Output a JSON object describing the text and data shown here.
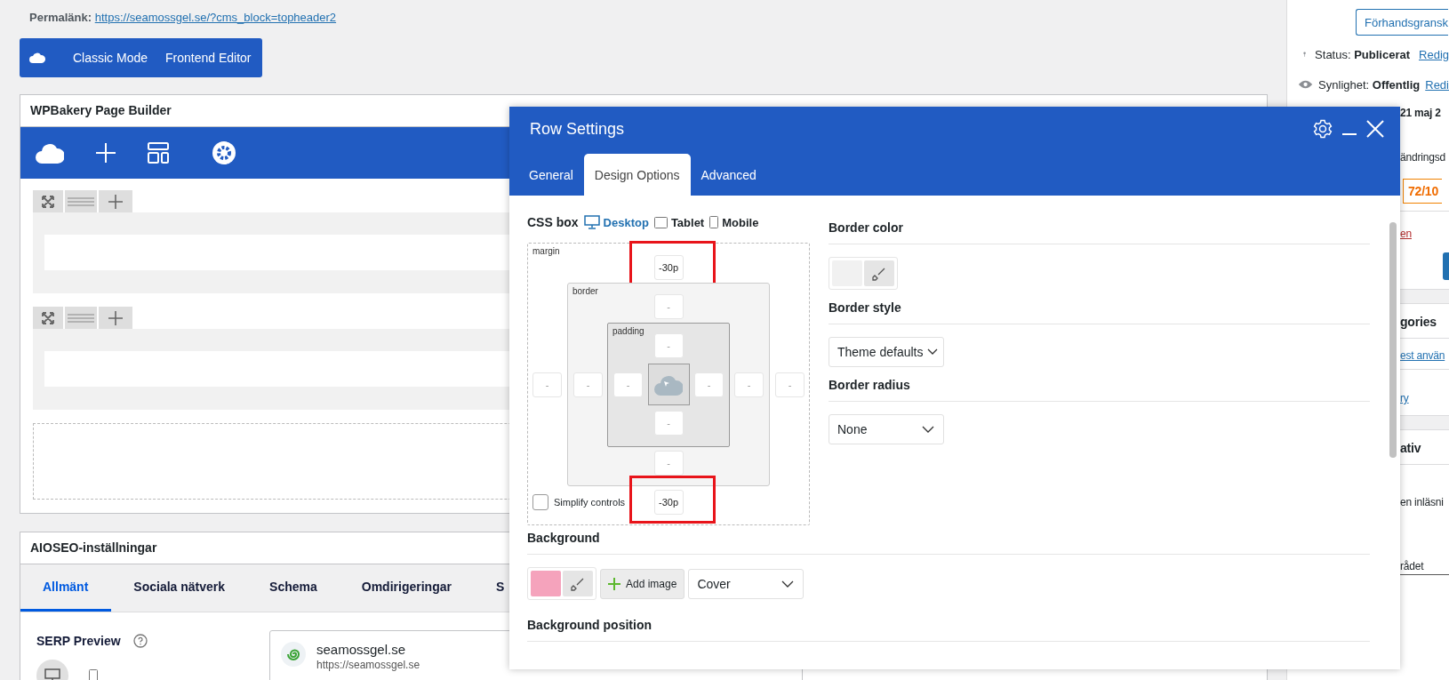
{
  "permalink": {
    "label": "Permalänk:",
    "url": "https://seamossgel.se/?cms_block=topheader2"
  },
  "editor_switch": {
    "buttons": [
      "Classic Mode",
      "Frontend Editor"
    ]
  },
  "page_builder": {
    "title": "WPBakery Page Builder"
  },
  "seo_panel": {
    "title": "AIOSEO-inställningar",
    "tabs": [
      {
        "label": "Allmänt",
        "selected": true
      },
      {
        "label": "Sociala nätverk",
        "selected": false
      },
      {
        "label": "Schema",
        "selected": false
      },
      {
        "label": "Omdirigeringar",
        "selected": false
      },
      {
        "label": "S",
        "selected": false
      }
    ],
    "serp_label": "SERP Preview",
    "serp_devices": [
      {
        "kind": "desktop",
        "selected": true
      },
      {
        "kind": "mobile",
        "selected": false
      }
    ],
    "site_name": "seamossgel.se",
    "site_url": "https://seamossgel.se"
  },
  "sidebar": {
    "preview_button": "Förhandsgransk",
    "status": {
      "label": "Status:",
      "value": "Publicerat",
      "link": "Redig"
    },
    "visibility": {
      "label": "Synlighet:",
      "value": "Offentlig",
      "link": "Redi"
    },
    "date": "21 maj 2",
    "revision": "ändringsd",
    "score": "72/10",
    "trash_link": "en",
    "categories_title": "gories",
    "categories_link": "est använ",
    "add_category_link": "ry",
    "section_title": "ativ",
    "note": "en inläsni",
    "field_label": "rådet"
  },
  "modal": {
    "title": "Row Settings",
    "tabs": [
      {
        "label": "General",
        "selected": false
      },
      {
        "label": "Design Options",
        "selected": true
      },
      {
        "label": "Advanced",
        "selected": false
      }
    ],
    "css_box": {
      "label": "CSS box",
      "devices": [
        {
          "kind": "desktop",
          "label": "Desktop",
          "selected": true
        },
        {
          "kind": "tablet",
          "label": "Tablet",
          "selected": false
        },
        {
          "kind": "mobile",
          "label": "Mobile",
          "selected": false
        }
      ],
      "margin": {
        "label": "margin",
        "top": {
          "value": "-30p",
          "highlighted": true
        },
        "right": {
          "placeholder": "-"
        },
        "bottom": {
          "value": "-30p",
          "highlighted": true
        },
        "left": {
          "placeholder": "-"
        }
      },
      "border": {
        "label": "border",
        "top": {
          "placeholder": "-"
        },
        "right": {
          "placeholder": "-"
        },
        "bottom": {
          "placeholder": "-"
        },
        "left": {
          "placeholder": "-"
        }
      },
      "padding": {
        "label": "padding",
        "top": {
          "placeholder": "-"
        },
        "right": {
          "placeholder": "-"
        },
        "bottom": {
          "placeholder": "-"
        },
        "left": {
          "placeholder": "-"
        }
      },
      "simplify": {
        "label": "Simplify controls",
        "checked": false
      }
    },
    "border_color": {
      "label": "Border color"
    },
    "border_style": {
      "label": "Border style",
      "value": "Theme defaults"
    },
    "border_radius": {
      "label": "Border radius",
      "value": "None"
    },
    "background": {
      "label": "Background",
      "color": "#f5a3bc",
      "add_image": "Add image",
      "size": "Cover"
    },
    "background_position": {
      "label": "Background position"
    }
  }
}
